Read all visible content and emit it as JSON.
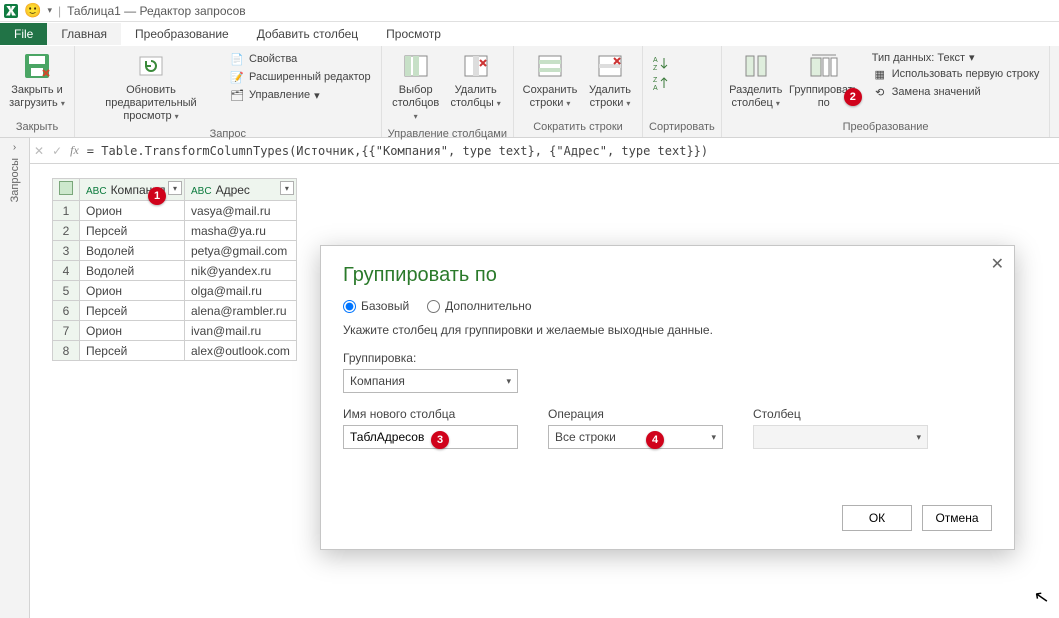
{
  "titlebar": {
    "title": "Таблица1 — Редактор запросов",
    "sep": "|",
    "dd": "▾"
  },
  "tabs": {
    "file": "File",
    "home": "Главная",
    "transform": "Преобразование",
    "addcol": "Добавить столбец",
    "view": "Просмотр"
  },
  "ribbon": {
    "close": {
      "label1": "Закрыть и",
      "label2": "загрузить",
      "group": "Закрыть"
    },
    "refresh": {
      "label1": "Обновить предварительный",
      "label2": "просмотр"
    },
    "props": "Свойства",
    "adveditor": "Расширенный редактор",
    "manage": "Управление",
    "group_query": "Запрос",
    "choosecols": {
      "l1": "Выбор",
      "l2": "столбцов"
    },
    "removecols": {
      "l1": "Удалить",
      "l2": "столбцы"
    },
    "group_cols": "Управление столбцами",
    "keeprows": {
      "l1": "Сохранить",
      "l2": "строки"
    },
    "removerows": {
      "l1": "Удалить",
      "l2": "строки"
    },
    "group_rows": "Сократить строки",
    "sort_group": "Сортировать",
    "split": {
      "l1": "Разделить",
      "l2": "столбец"
    },
    "groupby": {
      "l1": "Группировать",
      "l2": "по"
    },
    "datatype": "Тип данных: Текст",
    "firstrow": "Использовать первую строку",
    "replace": "Замена значений",
    "group_transform": "Преобразование"
  },
  "formula": {
    "text": "= Table.TransformColumnTypes(Источник,{{\"Компания\", type text}, {\"Адрес\", type text}})",
    "fx": "fx"
  },
  "sidepanel": {
    "label": "Запросы",
    "chev": "›"
  },
  "table": {
    "col1": "Компания",
    "col2": "Адрес",
    "type_prefix": "АBC",
    "rows": [
      {
        "n": "1",
        "c": "Орион",
        "a": "vasya@mail.ru"
      },
      {
        "n": "2",
        "c": "Персей",
        "a": "masha@ya.ru"
      },
      {
        "n": "3",
        "c": "Водолей",
        "a": "petya@gmail.com"
      },
      {
        "n": "4",
        "c": "Водолей",
        "a": "nik@yandex.ru"
      },
      {
        "n": "5",
        "c": "Орион",
        "a": "olga@mail.ru"
      },
      {
        "n": "6",
        "c": "Персей",
        "a": "alena@rambler.ru"
      },
      {
        "n": "7",
        "c": "Орион",
        "a": "ivan@mail.ru"
      },
      {
        "n": "8",
        "c": "Персей",
        "a": "alex@outlook.com"
      }
    ]
  },
  "dialog": {
    "title": "Группировать по",
    "radio_basic": "Базовый",
    "radio_adv": "Дополнительно",
    "desc": "Укажите столбец для группировки и желаемые выходные данные.",
    "group_label": "Группировка:",
    "group_value": "Компания",
    "newcol_label": "Имя нового столбца",
    "newcol_value": "ТаблАдресов",
    "op_label": "Операция",
    "op_value": "Все строки",
    "col_label": "Столбец",
    "col_value": "",
    "ok": "ОК",
    "cancel": "Отмена"
  },
  "badges": {
    "b1": "1",
    "b2": "2",
    "b3": "3",
    "b4": "4"
  }
}
